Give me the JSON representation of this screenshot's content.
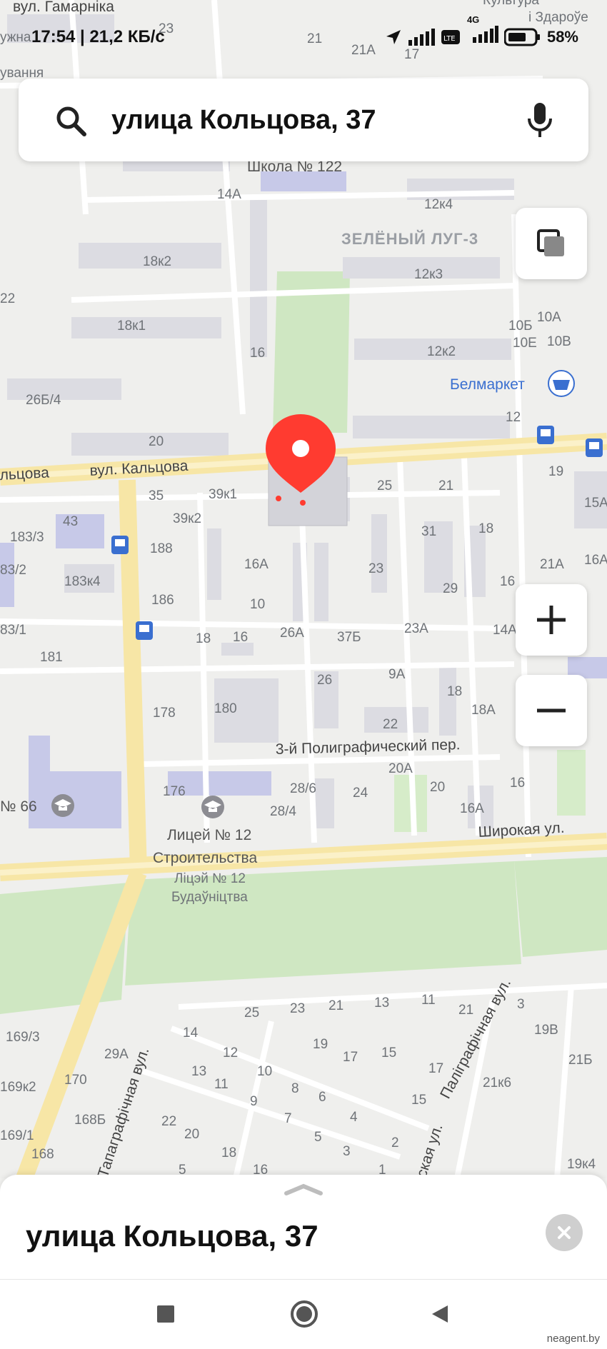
{
  "status_bar": {
    "time_speed": "17:54 | 21,2 КБ/с",
    "network": "4G",
    "battery": "58%"
  },
  "search": {
    "value": "улица Кольцова, 37",
    "icons": {
      "search": "search-icon",
      "mic": "mic-icon"
    }
  },
  "map": {
    "district": "ЗЕЛЁНЫЙ ЛУГ-3",
    "streets": {
      "top_left": "вул. Гамарніка",
      "koltsova_ru": "льцова",
      "koltsova_be": "вул. Кальцова",
      "poligraf_3": "3-й Полиграфический пер.",
      "shirokaya": "Широкая ул.",
      "tapagraf": "Тапаграфічная вул.",
      "paligraf": "Паліграфічная вул.",
      "skaya": "ская ул."
    },
    "pois": {
      "belmarket": "Белмаркет",
      "school": "Школа № 122",
      "lyceum_ru_1": "Лицей № 12",
      "lyceum_ru_2": "Строительства",
      "lyceum_be_1": "Ліцэй № 12",
      "lyceum_be_2": "Будаўніцтва",
      "school66": "№ 66",
      "top_right_1": "Культура",
      "top_right_2": "і Здароўе",
      "top_left_3": "ужна",
      "top_left_4": "ування"
    },
    "house_numbers": {
      "n23top": "23",
      "n21top": "21",
      "n21a_top": "21А",
      "n17top": "17",
      "n14a": "14А",
      "n12k4": "12к4",
      "n18k2": "18к2",
      "n12k3": "12к3",
      "n22": "22",
      "n18k1": "18к1",
      "n16_mid": "16",
      "n10b": "10Б",
      "n10a": "10А",
      "n10e": "10Е",
      "n10v": "10В",
      "n12k2": "12к2",
      "n26b4": "26Б/4",
      "n12": "12",
      "n20": "20",
      "n19": "19",
      "n35": "35",
      "n39k1": "39к1",
      "n25": "25",
      "n21": "21",
      "n15a": "15А",
      "n43": "43",
      "n39k2": "39к2",
      "n31": "31",
      "n18_r": "18",
      "n183_3": "183/3",
      "n188": "188",
      "n16a": "16А",
      "n23": "23",
      "n21a": "21А",
      "n16a_r": "16А",
      "n83_2": "83/2",
      "n183k4": "183к4",
      "n29": "29",
      "n16_r": "16",
      "n186": "186",
      "n10": "10",
      "n83_1": "83/1",
      "n18": "18",
      "n16": "16",
      "n26a": "26А",
      "n37b": "37Б",
      "n23a": "23А",
      "n14a_r": "14А",
      "n181": "181",
      "n9a": "9А",
      "n26": "26",
      "n18_c": "18",
      "n178": "178",
      "n180": "180",
      "n18a": "18А",
      "n22_c": "22",
      "n20a": "20А",
      "n176": "176",
      "n28_6": "28/6",
      "n24": "24",
      "n20_c": "20",
      "n16_c": "16",
      "n28_4": "28/4",
      "n16a_c": "16А",
      "b25": "25",
      "b23": "23",
      "b21": "21",
      "b13": "13",
      "b11": "11",
      "b21_r": "21",
      "b3": "3",
      "b169_3": "169/3",
      "b14": "14",
      "b19": "19",
      "b19v": "19В",
      "b29a": "29А",
      "b12": "12",
      "b17": "17",
      "b15": "15",
      "b21b": "21Б",
      "b13_2": "13",
      "b10": "10",
      "b17_2": "17",
      "b169k2": "169к2",
      "b170": "170",
      "b11_2": "11",
      "b8": "8",
      "b6": "6",
      "b21k6": "21к6",
      "b9": "9",
      "b15_2": "15",
      "b168b": "168Б",
      "b22": "22",
      "b7": "7",
      "b4": "4",
      "b169_1": "169/1",
      "b20": "20",
      "b5": "5",
      "b3_2": "3",
      "b2": "2",
      "b168": "168",
      "b18": "18",
      "b16": "16",
      "b19k4": "19к4",
      "b5_2": "5",
      "b1": "1"
    }
  },
  "controls": {
    "layers": "layers-icon",
    "zoom_in": "plus-icon",
    "zoom_out": "minus-icon"
  },
  "bottom_sheet": {
    "title": "улица Кольцова, 37"
  },
  "nav": {
    "recent": "square-icon",
    "home": "circle-icon",
    "back": "triangle-back-icon"
  },
  "watermark": "neagent.by",
  "colors": {
    "accent": "#ff3b30",
    "park": "#cde8c1",
    "road": "#f7e7a8",
    "building": "#dddde2"
  }
}
